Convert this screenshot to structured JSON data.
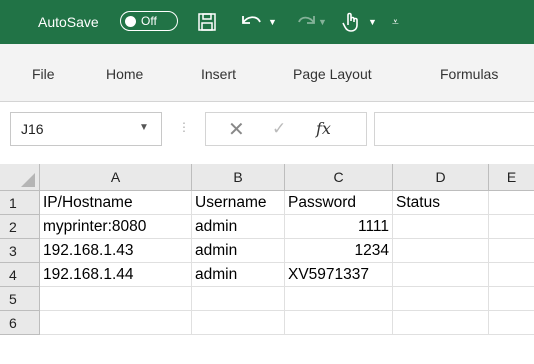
{
  "titlebar": {
    "autosave_label": "AutoSave",
    "autosave_state": "Off",
    "bg_color": "#217346"
  },
  "ribbon": {
    "tabs": [
      "File",
      "Home",
      "Insert",
      "Page Layout",
      "Formulas"
    ]
  },
  "formula_bar": {
    "name_box": "J16",
    "fx_label": "fx",
    "formula": ""
  },
  "grid": {
    "columns": [
      "A",
      "B",
      "C",
      "D",
      "E"
    ],
    "rows": [
      "1",
      "2",
      "3",
      "4",
      "5",
      "6"
    ],
    "cells": [
      [
        "IP/Hostname",
        "Username",
        "Password",
        "Status"
      ],
      [
        "myprinter:8080",
        "admin",
        "1111",
        ""
      ],
      [
        "192.168.1.43",
        "admin",
        "1234",
        ""
      ],
      [
        "192.168.1.44",
        "admin",
        "XV5971337",
        ""
      ],
      [
        "",
        "",
        "",
        ""
      ],
      [
        "",
        "",
        "",
        ""
      ]
    ]
  }
}
